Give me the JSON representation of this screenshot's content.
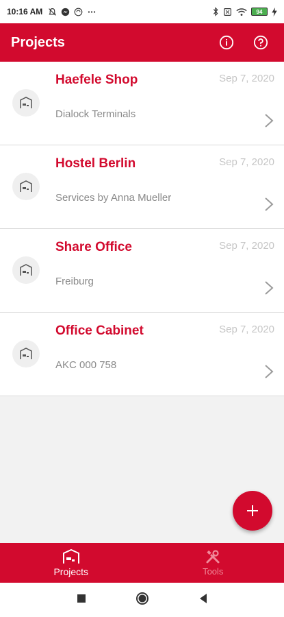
{
  "status_bar": {
    "time": "10:16 AM",
    "battery_level": "94"
  },
  "app_bar": {
    "title": "Projects"
  },
  "projects": [
    {
      "name": "Haefele Shop",
      "subtitle": "Dialock Terminals",
      "date": "Sep 7, 2020"
    },
    {
      "name": "Hostel Berlin",
      "subtitle": "Services by Anna Mueller",
      "date": "Sep 7, 2020"
    },
    {
      "name": "Share Office",
      "subtitle": "Freiburg",
      "date": "Sep 7, 2020"
    },
    {
      "name": "Office Cabinet",
      "subtitle": "AKC 000 758",
      "date": "Sep 7, 2020"
    }
  ],
  "bottom_nav": {
    "projects_label": "Projects",
    "tools_label": "Tools"
  },
  "colors": {
    "brand": "#d20a2e",
    "list_bg": "#f2f2f2",
    "date": "#c6c6c6",
    "subtitle": "#8a8a8a"
  }
}
